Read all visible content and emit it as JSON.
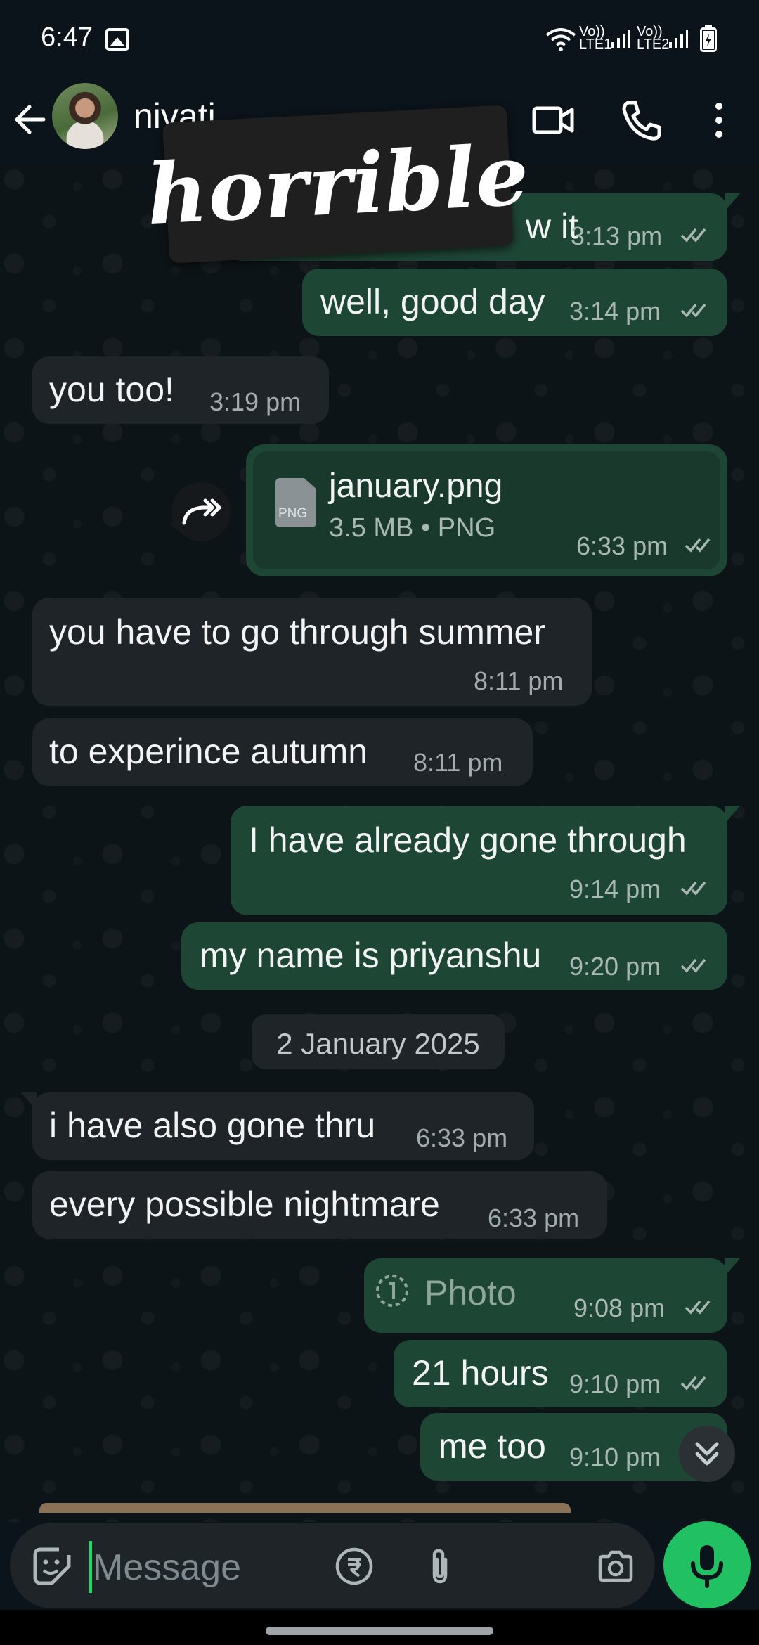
{
  "status_bar": {
    "time": "6:47",
    "sim1_label": "Vo)) LTE1",
    "sim2_label": "Vo)) LTE2",
    "icons": [
      "gallery-icon",
      "wifi-icon",
      "signal-icon",
      "battery-icon"
    ]
  },
  "header": {
    "contact_name": "nivati",
    "icons": [
      "back-arrow-icon",
      "video-call-icon",
      "phone-icon",
      "more-options-icon"
    ]
  },
  "sticker": {
    "text": "horrible"
  },
  "messages": [
    {
      "direction": "out",
      "partial_text": "w it",
      "time": "3:13 pm"
    },
    {
      "direction": "out",
      "text": "well, good day",
      "time": "3:14 pm"
    },
    {
      "direction": "in",
      "text": "you too!",
      "time": "3:19 pm"
    },
    {
      "direction": "out",
      "type": "document",
      "file_name": "january.png",
      "file_meta": "3.5 MB • PNG",
      "file_icon": "PNG",
      "time": "6:33 pm"
    },
    {
      "direction": "in",
      "text": "you have to go through summer",
      "time": "8:11 pm"
    },
    {
      "direction": "in",
      "text": "to experince autumn",
      "time": "8:11 pm"
    },
    {
      "direction": "out",
      "text": "I have already gone through",
      "time": "9:14 pm"
    },
    {
      "direction": "out",
      "text": "my name is priyanshu",
      "time": "9:20 pm"
    },
    {
      "direction": "in",
      "text": "i have also gone thru",
      "time": "6:33 pm"
    },
    {
      "direction": "in",
      "text": "every possible nightmare",
      "time": "6:33 pm"
    },
    {
      "direction": "out",
      "type": "photo",
      "text": "Photo",
      "time": "9:08 pm"
    },
    {
      "direction": "out",
      "text": "21 hours",
      "time": "9:10 pm"
    },
    {
      "direction": "out",
      "text": "me too",
      "time": "9:10 pm"
    }
  ],
  "date_separator": "2 January 2025",
  "input": {
    "placeholder": "Message",
    "icons": [
      "emoji-icon",
      "attach-icon",
      "rupee-payment-icon",
      "camera-icon",
      "mic-icon"
    ]
  },
  "colors": {
    "outgoing_bubble": "#1e4635",
    "incoming_bubble": "#1f2428",
    "accent_green": "#21c063",
    "read_tick": "#a9b8b1"
  }
}
